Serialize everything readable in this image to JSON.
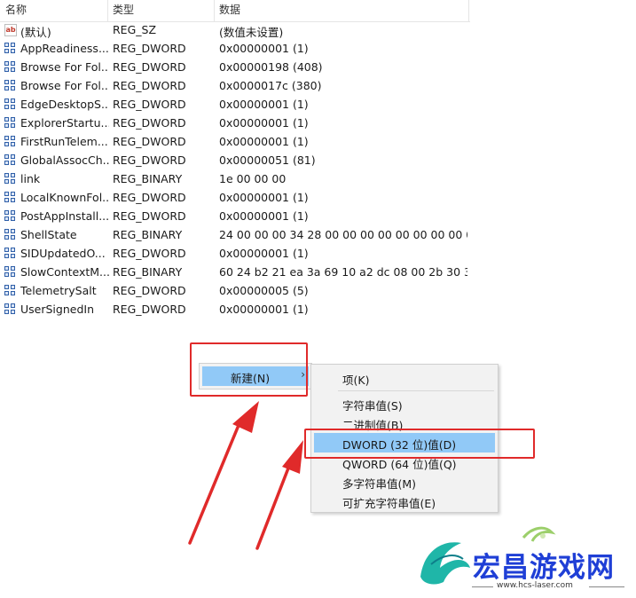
{
  "columns": {
    "name": "名称",
    "type": "类型",
    "data": "数据"
  },
  "rows": [
    {
      "icon": "string-value-icon",
      "name": "(默认)",
      "type": "REG_SZ",
      "data": "(数值未设置)"
    },
    {
      "icon": "binary-value-icon",
      "name": "AppReadiness...",
      "type": "REG_DWORD",
      "data": "0x00000001 (1)"
    },
    {
      "icon": "binary-value-icon",
      "name": "Browse For Fol...",
      "type": "REG_DWORD",
      "data": "0x00000198 (408)"
    },
    {
      "icon": "binary-value-icon",
      "name": "Browse For Fol...",
      "type": "REG_DWORD",
      "data": "0x0000017c (380)"
    },
    {
      "icon": "binary-value-icon",
      "name": "EdgeDesktopS...",
      "type": "REG_DWORD",
      "data": "0x00000001 (1)"
    },
    {
      "icon": "binary-value-icon",
      "name": "ExplorerStartu...",
      "type": "REG_DWORD",
      "data": "0x00000001 (1)"
    },
    {
      "icon": "binary-value-icon",
      "name": "FirstRunTelem...",
      "type": "REG_DWORD",
      "data": "0x00000001 (1)"
    },
    {
      "icon": "binary-value-icon",
      "name": "GlobalAssocCh...",
      "type": "REG_DWORD",
      "data": "0x00000051 (81)"
    },
    {
      "icon": "binary-value-icon",
      "name": "link",
      "type": "REG_BINARY",
      "data": "1e 00 00 00"
    },
    {
      "icon": "binary-value-icon",
      "name": "LocalKnownFol...",
      "type": "REG_DWORD",
      "data": "0x00000001 (1)"
    },
    {
      "icon": "binary-value-icon",
      "name": "PostAppInstall...",
      "type": "REG_DWORD",
      "data": "0x00000001 (1)"
    },
    {
      "icon": "binary-value-icon",
      "name": "ShellState",
      "type": "REG_BINARY",
      "data": "24 00 00 00 34 28 00 00 00 00 00 00 00 00 00..."
    },
    {
      "icon": "binary-value-icon",
      "name": "SIDUpdatedO...",
      "type": "REG_DWORD",
      "data": "0x00000001 (1)"
    },
    {
      "icon": "binary-value-icon",
      "name": "SlowContextM...",
      "type": "REG_BINARY",
      "data": "60 24 b2 21 ea 3a 69 10 a2 dc 08 00 2b 30 3..."
    },
    {
      "icon": "binary-value-icon",
      "name": "TelemetrySalt",
      "type": "REG_DWORD",
      "data": "0x00000005 (5)"
    },
    {
      "icon": "binary-value-icon",
      "name": "UserSignedIn",
      "type": "REG_DWORD",
      "data": "0x00000001 (1)"
    }
  ],
  "context_menu": {
    "new_label": "新建(N)",
    "arrow": "›"
  },
  "submenu": {
    "key": "项(K)",
    "string": "字符串值(S)",
    "binary": "二进制值(B)",
    "dword": "DWORD (32 位)值(D)",
    "qword": "QWORD (64 位)值(Q)",
    "multi_string": "多字符串值(M)",
    "expand_string": "可扩充字符串值(E)"
  },
  "watermark": {
    "title": "宏昌游戏网",
    "url": "www.hcs-laser.com"
  },
  "colors": {
    "highlight": "#91c9f7",
    "annotation_red": "#e02a2a",
    "watermark_blue": "#1f3fd6"
  }
}
